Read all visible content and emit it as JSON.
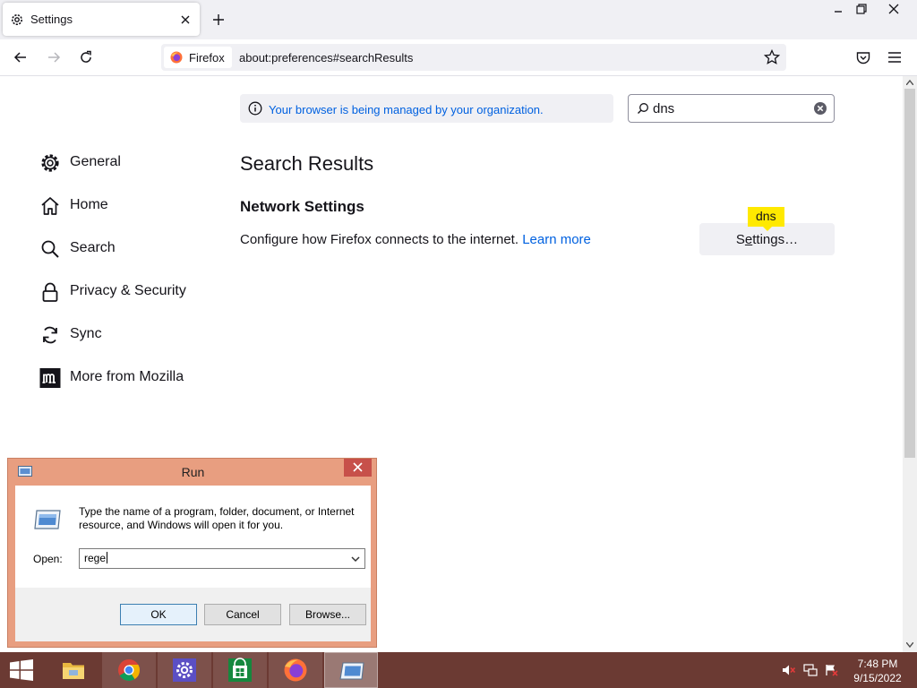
{
  "browser": {
    "tab": {
      "title": "Settings"
    },
    "url": {
      "identity_label": "Firefox",
      "address": "about:preferences#searchResults"
    }
  },
  "policy_notice": {
    "text": "Your browser is being managed by your organization."
  },
  "search": {
    "value": "dns"
  },
  "categories": [
    {
      "label": "General",
      "icon": "gear-icon"
    },
    {
      "label": "Home",
      "icon": "home-icon"
    },
    {
      "label": "Search",
      "icon": "search-icon"
    },
    {
      "label": "Privacy & Security",
      "icon": "lock-icon"
    },
    {
      "label": "Sync",
      "icon": "sync-icon"
    },
    {
      "label": "More from Mozilla",
      "icon": "mozilla-icon"
    }
  ],
  "results": {
    "title": "Search Results",
    "section_title": "Network Settings",
    "description": "Configure how Firefox connects to the internet.",
    "learn_more": "Learn more",
    "button_label_pre": "S",
    "button_label_underlined": "e",
    "button_label_post": "ttings…",
    "highlight_tooltip": "dns"
  },
  "run_dialog": {
    "title": "Run",
    "message": "Type the name of a program, folder, document, or Internet resource, and Windows will open it for you.",
    "open_label": "Open:",
    "input_value": "rege",
    "ok_label": "OK",
    "cancel_label": "Cancel",
    "browse_label": "Browse..."
  },
  "taskbar": {
    "items": [
      "file-explorer-icon",
      "chrome-icon",
      "settings-app-icon",
      "store-icon",
      "firefox-icon",
      "run-icon"
    ],
    "clock_time": "7:48 PM",
    "clock_date": "9/15/2022"
  },
  "colors": {
    "accent": "#0061e0",
    "highlight": "#ffe900",
    "taskbar": "#6b3a33",
    "dialog_frame": "#e89e80"
  }
}
